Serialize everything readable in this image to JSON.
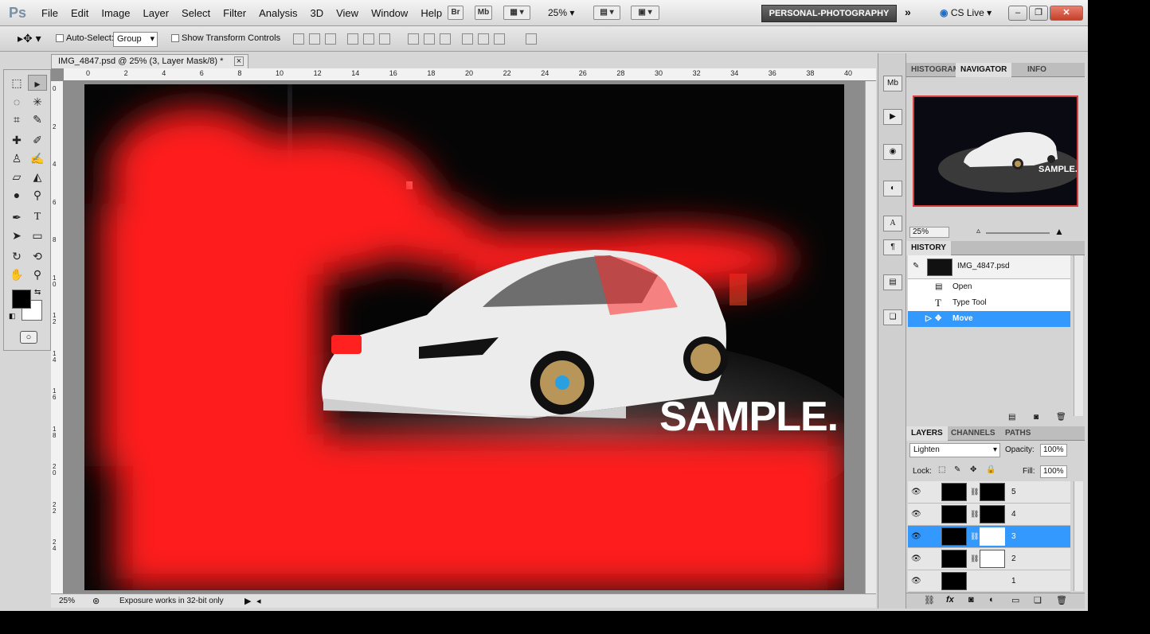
{
  "app": {
    "logo": "Ps",
    "workspace": "PERSONAL-PHOTOGRAPHY",
    "cslive": "CS Live ▾",
    "zoom": "25%"
  },
  "menu": [
    "File",
    "Edit",
    "Image",
    "Layer",
    "Select",
    "Filter",
    "Analysis",
    "3D",
    "View",
    "Window",
    "Help"
  ],
  "bridge": {
    "br": "Br",
    "mb": "Mb"
  },
  "options": {
    "auto_select": "Auto-Select:",
    "group": "Group",
    "transform": "Show Transform Controls"
  },
  "document": {
    "tab_title": "IMG_4847.psd @ 25% (3, Layer Mask/8) *",
    "close": "×",
    "watermark": "SAMPLE."
  },
  "ruler": {
    "top": [
      "0",
      "2",
      "4",
      "6",
      "8",
      "10",
      "12",
      "14",
      "16",
      "18",
      "20",
      "22",
      "24",
      "26",
      "28",
      "30",
      "32",
      "34",
      "36",
      "38",
      "40"
    ],
    "left": [
      "0",
      "2",
      "4",
      "6",
      "8",
      "1 0",
      "1 2",
      "1 4",
      "1 6",
      "1 8",
      "2 0",
      "2 2",
      "2 4"
    ]
  },
  "status": {
    "zoom": "25%",
    "message": "Exposure works in 32-bit only"
  },
  "navigator": {
    "tabs": [
      "HISTOGRAM",
      "NAVIGATOR",
      "INFO"
    ],
    "zoom": "25%",
    "thumb_text": "SAMPLE."
  },
  "history": {
    "tab": "HISTORY",
    "snapshot": "IMG_4847.psd",
    "items": [
      "Open",
      "Type Tool",
      "Move"
    ]
  },
  "layers": {
    "tabs": [
      "LAYERS",
      "CHANNELS",
      "PATHS"
    ],
    "blend": "Lighten",
    "opacity_label": "Opacity:",
    "opacity": "100%",
    "lock_label": "Lock:",
    "fill_label": "Fill:",
    "fill": "100%",
    "items": [
      "5",
      "4",
      "3",
      "2",
      "1"
    ],
    "selected": "3"
  },
  "colors": {
    "accent": "#3399ff",
    "red_mask": "#ff1a1a"
  }
}
